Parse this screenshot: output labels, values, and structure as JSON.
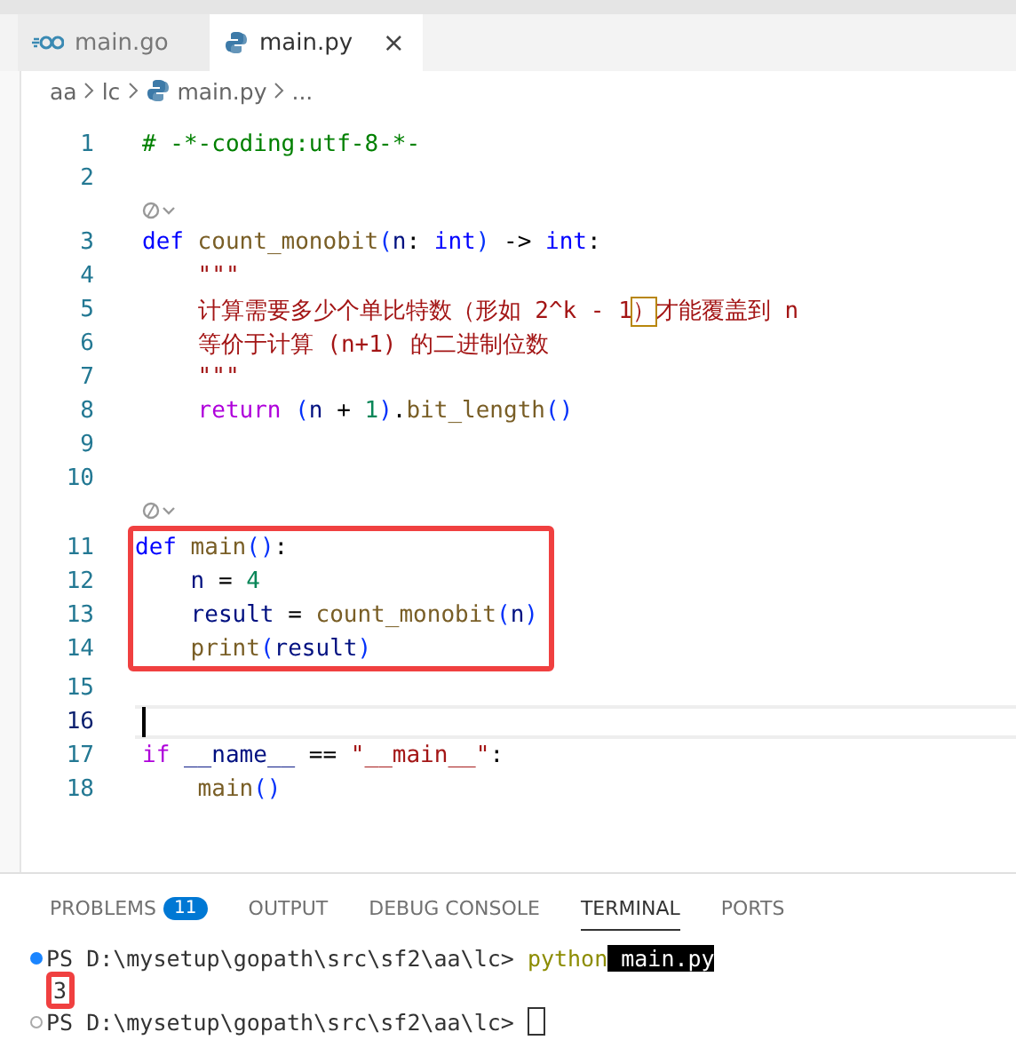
{
  "tabs": [
    {
      "label": "main.go",
      "kind": "go",
      "selected": false,
      "closable": false
    },
    {
      "label": "main.py",
      "kind": "python",
      "selected": true,
      "closable": true
    }
  ],
  "close_glyph": "×",
  "breadcrumbs": [
    "aa",
    "lc",
    "main.py",
    "..."
  ],
  "code_lines": [
    {
      "kind": "line",
      "number": "1",
      "tokens": [
        {
          "t": "# -*-coding:utf-8-*-",
          "kind": "comment"
        }
      ]
    },
    {
      "kind": "line",
      "number": "2"
    },
    {
      "kind": "lens"
    },
    {
      "kind": "line",
      "number": "3",
      "tokens": [
        {
          "t": "def",
          "kind": "kw"
        },
        {
          "t": " count_monobit",
          "kind": "fn"
        },
        {
          "t": "(",
          "kind": "paren"
        },
        {
          "t": "n",
          "kind": "var"
        },
        {
          "t": ": ",
          "kind": "plain"
        },
        {
          "t": "int",
          "kind": "kw"
        },
        {
          "t": ")",
          "kind": "paren"
        },
        {
          "t": " -> ",
          "kind": "plain"
        },
        {
          "t": "int",
          "kind": "kw"
        },
        {
          "t": ":",
          "kind": "plain"
        }
      ]
    },
    {
      "kind": "line",
      "number": "4",
      "indented": true,
      "tokens": [
        {
          "t": "\"\"\"",
          "kind": "string"
        }
      ]
    },
    {
      "kind": "line",
      "number": "5",
      "indented": true,
      "tokens": [
        {
          "t": "计算需要多少个单比特数（形如 2^k - 1",
          "kind": "string"
        },
        {
          "t": "）",
          "kind": "string",
          "matched": true
        },
        {
          "t": "才能覆盖到 n",
          "kind": "string"
        }
      ]
    },
    {
      "kind": "line",
      "number": "6",
      "indented": true,
      "tokens": [
        {
          "t": "等价于计算 (n+1) 的二进制位数",
          "kind": "string"
        }
      ]
    },
    {
      "kind": "line",
      "number": "7",
      "indented": true,
      "tokens": [
        {
          "t": "\"\"\"",
          "kind": "string"
        }
      ]
    },
    {
      "kind": "line",
      "number": "8",
      "indented": true,
      "tokens": [
        {
          "t": "return",
          "kind": "ctrl"
        },
        {
          "t": " (",
          "kind": "paren"
        },
        {
          "t": "n",
          "kind": "var"
        },
        {
          "t": " + ",
          "kind": "plain"
        },
        {
          "t": "1",
          "kind": "num"
        },
        {
          "t": ")",
          "kind": "paren"
        },
        {
          "t": ".",
          "kind": "plain"
        },
        {
          "t": "bit_length",
          "kind": "fn"
        },
        {
          "t": "()",
          "kind": "paren"
        }
      ]
    },
    {
      "kind": "line",
      "number": "9"
    },
    {
      "kind": "line",
      "number": "10"
    },
    {
      "kind": "lens"
    },
    {
      "kind": "line",
      "number": "11",
      "boxed": true,
      "tokens": [
        {
          "t": "def",
          "kind": "kw"
        },
        {
          "t": " main",
          "kind": "fn"
        },
        {
          "t": "()",
          "kind": "paren"
        },
        {
          "t": ":",
          "kind": "plain"
        }
      ]
    },
    {
      "kind": "line",
      "number": "12",
      "boxed": true,
      "indented": true,
      "tokens": [
        {
          "t": "n",
          "kind": "var"
        },
        {
          "t": " = ",
          "kind": "plain"
        },
        {
          "t": "4",
          "kind": "num"
        }
      ]
    },
    {
      "kind": "line",
      "number": "13",
      "boxed": true,
      "indented": true,
      "tokens": [
        {
          "t": "result",
          "kind": "var"
        },
        {
          "t": " = ",
          "kind": "plain"
        },
        {
          "t": "count_monobit",
          "kind": "fn"
        },
        {
          "t": "(",
          "kind": "paren"
        },
        {
          "t": "n",
          "kind": "var"
        },
        {
          "t": ")",
          "kind": "paren"
        }
      ]
    },
    {
      "kind": "line",
      "number": "14",
      "boxed": true,
      "indented": true,
      "tokens": [
        {
          "t": "print",
          "kind": "fn"
        },
        {
          "t": "(",
          "kind": "paren"
        },
        {
          "t": "result",
          "kind": "var"
        },
        {
          "t": ")",
          "kind": "paren"
        }
      ]
    },
    {
      "kind": "line",
      "number": "15"
    },
    {
      "kind": "line",
      "number": "16",
      "current": true
    },
    {
      "kind": "line",
      "number": "17",
      "tokens": [
        {
          "t": "if",
          "kind": "ctrl"
        },
        {
          "t": " __name__",
          "kind": "var"
        },
        {
          "t": " == ",
          "kind": "plain"
        },
        {
          "t": "\"__main__\"",
          "kind": "string"
        },
        {
          "t": ":",
          "kind": "plain"
        }
      ]
    },
    {
      "kind": "line",
      "number": "18",
      "indented": true,
      "tokens": [
        {
          "t": "main",
          "kind": "fn"
        },
        {
          "t": "()",
          "kind": "paren"
        }
      ]
    }
  ],
  "panel_tabs": [
    {
      "label": "PROBLEMS",
      "badge": "11",
      "selected": false
    },
    {
      "label": "OUTPUT",
      "selected": false
    },
    {
      "label": "DEBUG CONSOLE",
      "selected": false
    },
    {
      "label": "TERMINAL",
      "selected": true
    },
    {
      "label": "PORTS",
      "selected": false
    }
  ],
  "terminal_lines": [
    {
      "kind": "prompt",
      "succeeded": true,
      "prompt": "PS D:\\mysetup\\gopath\\src\\sf2\\aa\\lc> ",
      "command": "python",
      "selected_text": " main.py"
    },
    {
      "kind": "output",
      "text": "3",
      "boxed": true
    },
    {
      "kind": "prompt",
      "succeeded": false,
      "prompt": "PS D:\\mysetup\\gopath\\src\\sf2\\aa\\lc> ",
      "cursor": true
    }
  ]
}
